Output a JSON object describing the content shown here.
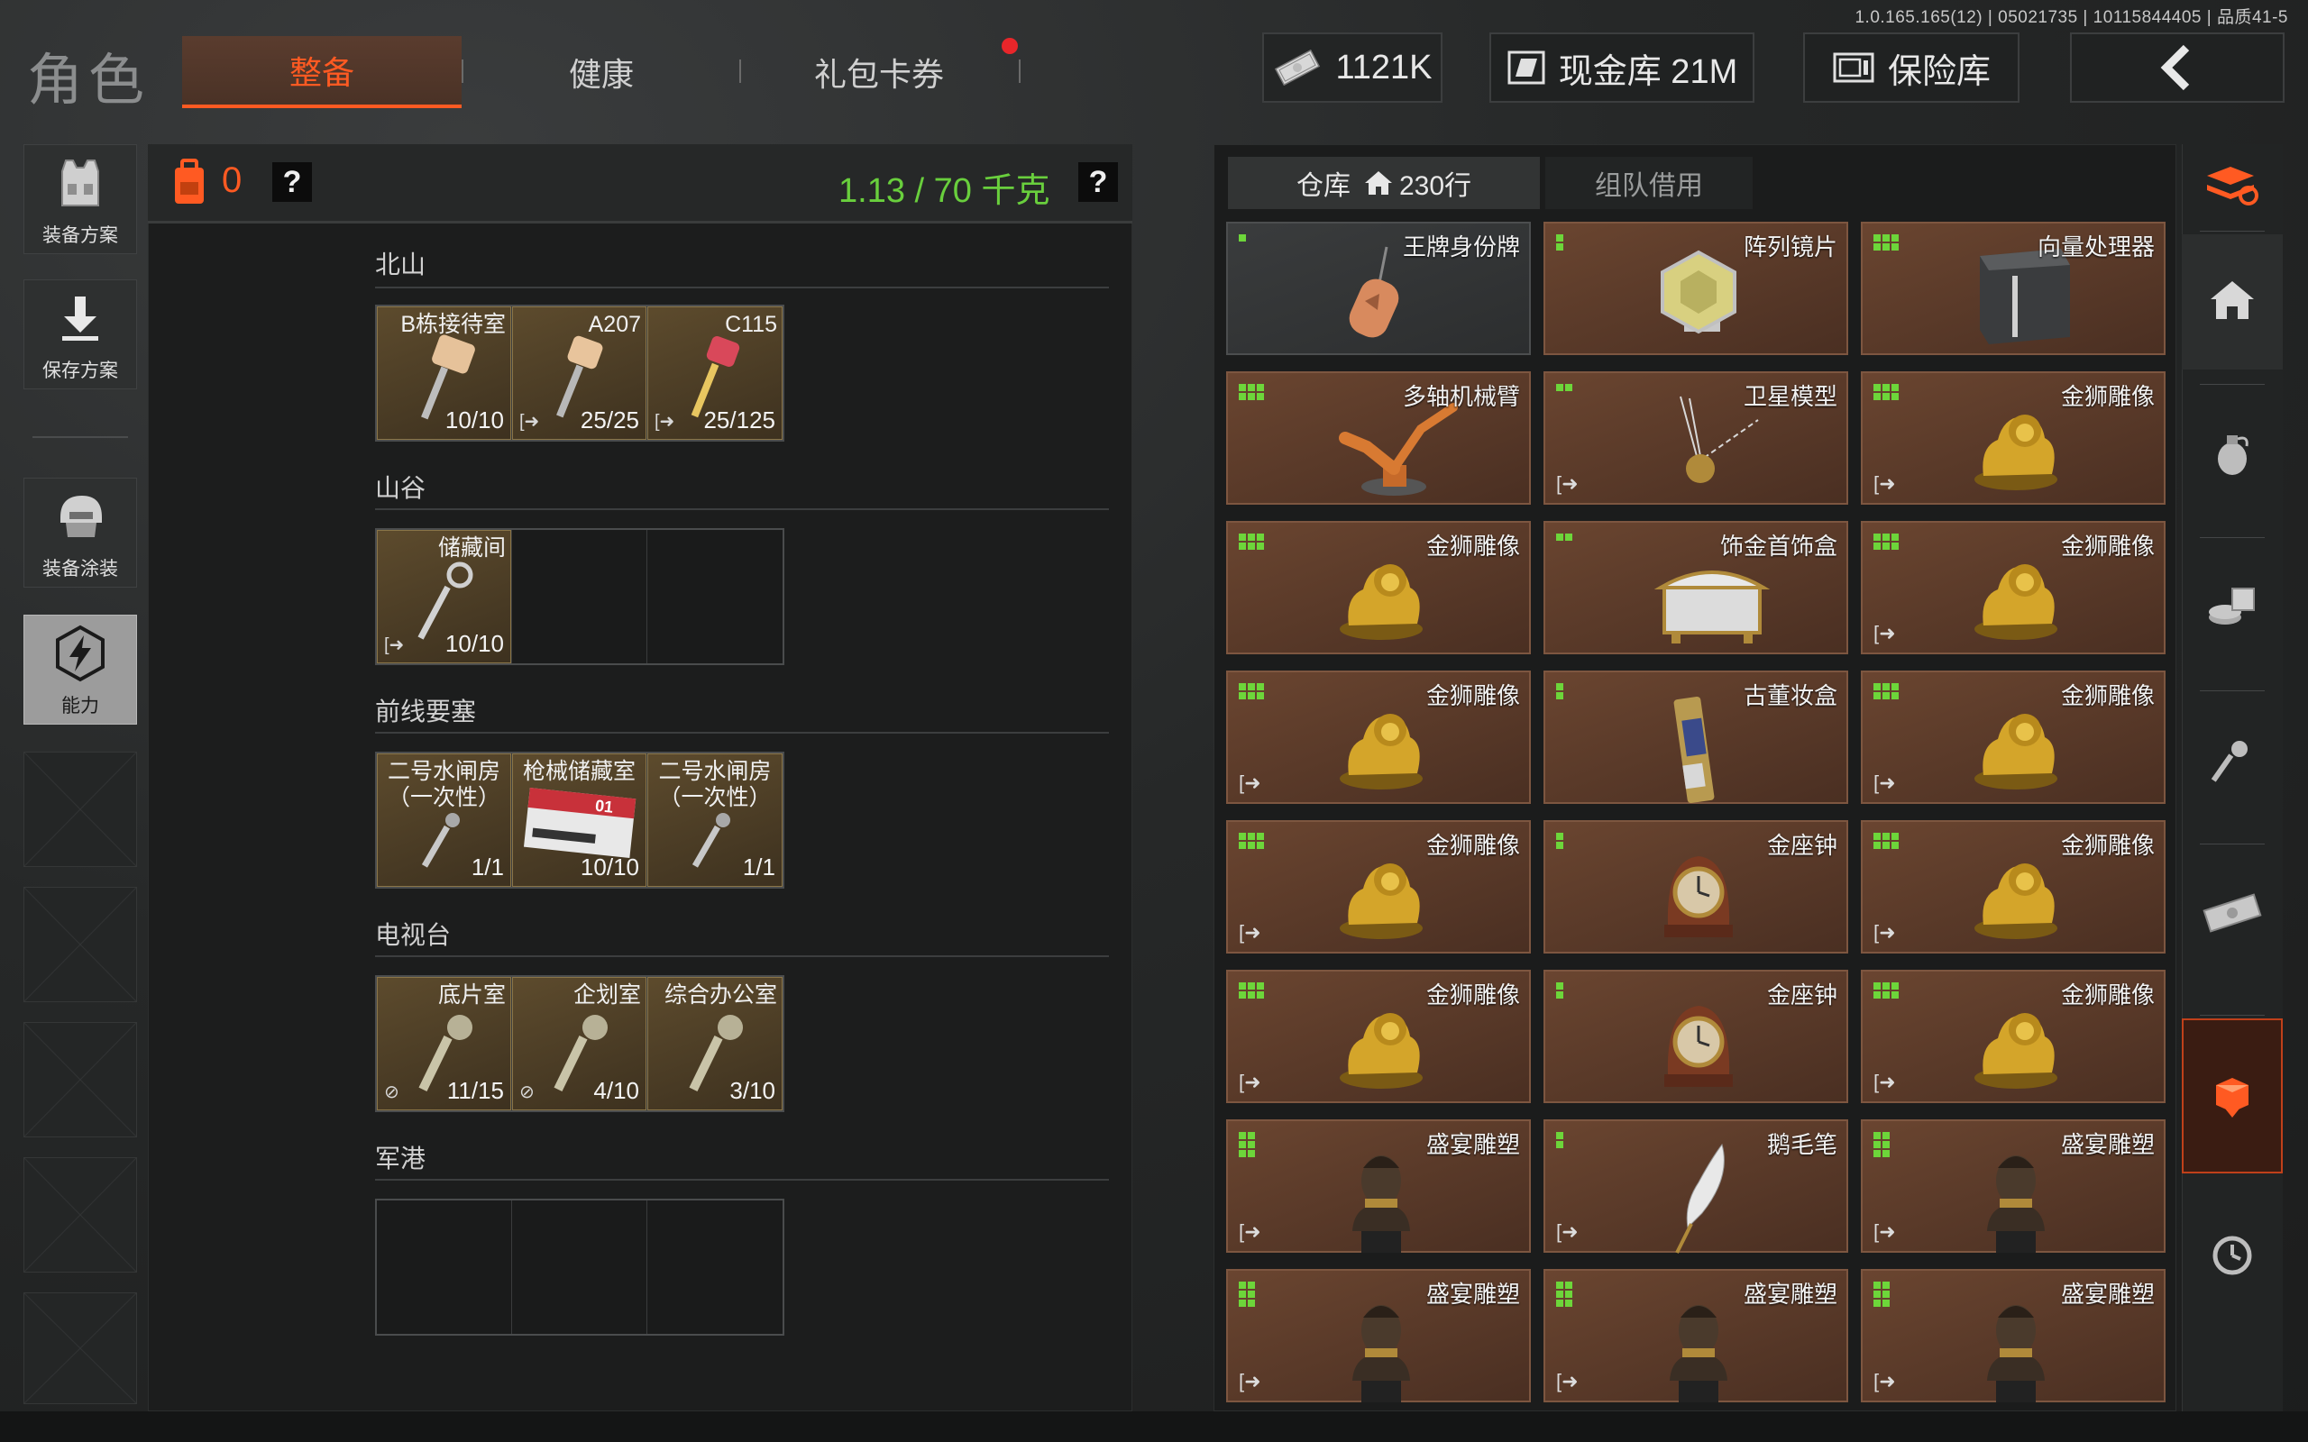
{
  "version": "1.0.165.165(12) | 05021735 | 10115844405 | 品质41-5",
  "page_title": "角色",
  "top_tabs": [
    {
      "label": "整备",
      "active": true
    },
    {
      "label": "健康",
      "active": false
    },
    {
      "label": "礼包卡券",
      "active": false,
      "badge": "red-dot"
    }
  ],
  "currency": {
    "label": "1121K",
    "icon": "cash-icon"
  },
  "cash_vault": {
    "label": "现金库 21M",
    "icon": "vault-icon"
  },
  "safe": {
    "label": "保险库",
    "icon": "safe-icon"
  },
  "back": {
    "icon": "back-arrow-icon"
  },
  "left_rail": [
    {
      "label": "装备方案",
      "icon": "vest-icon"
    },
    {
      "label": "保存方案",
      "icon": "download-icon"
    },
    {
      "label": "装备涂装",
      "icon": "helmet-icon"
    },
    {
      "label": "能力",
      "icon": "ability-icon",
      "active": true
    }
  ],
  "backpack": {
    "count": "0",
    "help": "?"
  },
  "weight": {
    "label": "1.13 / 70 千克",
    "help": "?"
  },
  "sections": [
    {
      "title": "北山",
      "keys": [
        {
          "name": "B栋接待室",
          "count": "10/10",
          "exit": false
        },
        {
          "name": "A207",
          "count": "25/25",
          "exit": true
        },
        {
          "name": "C115",
          "count": "25/125",
          "exit": true
        }
      ]
    },
    {
      "title": "山谷",
      "keys": [
        {
          "name": "储藏间",
          "count": "10/10",
          "exit": true
        }
      ]
    },
    {
      "title": "前线要塞",
      "keys": [
        {
          "name": "二号水闸房\n（一次性）",
          "count": "1/1",
          "exit": false
        },
        {
          "name": "枪械储藏室",
          "count": "10/10",
          "exit": false
        },
        {
          "name": "二号水闸房\n（一次性）",
          "count": "1/1",
          "exit": false
        }
      ]
    },
    {
      "title": "电视台",
      "keys": [
        {
          "name": "底片室",
          "count": "11/15",
          "exit": true
        },
        {
          "name": "企划室",
          "count": "4/10",
          "exit": true
        },
        {
          "name": "综合办公室",
          "count": "3/10",
          "exit": false
        }
      ]
    },
    {
      "title": "军港",
      "keys": []
    }
  ],
  "warehouse_tabs": [
    {
      "label": "仓库",
      "suffix": "230行",
      "icon": "home-icon",
      "active": true
    },
    {
      "label": "组队借用",
      "active": false
    }
  ],
  "items": [
    {
      "name": "王牌身份牌",
      "grid": "1x1",
      "exit": false,
      "art": "dogtag",
      "gray": true
    },
    {
      "name": "阵列镜片",
      "grid": "1x2",
      "exit": false,
      "art": "lens"
    },
    {
      "name": "向量处理器",
      "grid": "3x2",
      "exit": false,
      "art": "box"
    },
    {
      "name": "多轴机械臂",
      "grid": "3x2",
      "exit": false,
      "art": "arm"
    },
    {
      "name": "卫星模型",
      "grid": "2x1",
      "exit": true,
      "art": "satellite"
    },
    {
      "name": "金狮雕像",
      "grid": "3x2",
      "exit": true,
      "art": "lion"
    },
    {
      "name": "金狮雕像",
      "grid": "3x2",
      "exit": false,
      "art": "lion"
    },
    {
      "name": "饰金首饰盒",
      "grid": "2x1",
      "exit": false,
      "art": "jewelbox"
    },
    {
      "name": "金狮雕像",
      "grid": "3x2",
      "exit": true,
      "art": "lion"
    },
    {
      "name": "金狮雕像",
      "grid": "3x2",
      "exit": true,
      "art": "lion"
    },
    {
      "name": "古董妆盒",
      "grid": "1x2",
      "exit": false,
      "art": "vase"
    },
    {
      "name": "金狮雕像",
      "grid": "3x2",
      "exit": true,
      "art": "lion"
    },
    {
      "name": "金狮雕像",
      "grid": "3x2",
      "exit": true,
      "art": "lion"
    },
    {
      "name": "金座钟",
      "grid": "1x2",
      "exit": false,
      "art": "clock"
    },
    {
      "name": "金狮雕像",
      "grid": "3x2",
      "exit": true,
      "art": "lion"
    },
    {
      "name": "金狮雕像",
      "grid": "3x2",
      "exit": true,
      "art": "lion"
    },
    {
      "name": "金座钟",
      "grid": "1x2",
      "exit": false,
      "art": "clock"
    },
    {
      "name": "金狮雕像",
      "grid": "3x2",
      "exit": true,
      "art": "lion"
    },
    {
      "name": "盛宴雕塑",
      "grid": "2x3",
      "exit": true,
      "art": "bust"
    },
    {
      "name": "鹅毛笔",
      "grid": "1x2",
      "exit": true,
      "art": "quill"
    },
    {
      "name": "盛宴雕塑",
      "grid": "2x3",
      "exit": true,
      "art": "bust"
    },
    {
      "name": "盛宴雕塑",
      "grid": "2x3",
      "exit": true,
      "art": "bust"
    },
    {
      "name": "盛宴雕塑",
      "grid": "2x3",
      "exit": true,
      "art": "bust"
    },
    {
      "name": "盛宴雕塑",
      "grid": "2x3",
      "exit": true,
      "art": "bust"
    }
  ],
  "right_rail": [
    {
      "icon": "stack-refresh-icon",
      "active": false
    },
    {
      "icon": "home-icon",
      "active": false
    },
    {
      "icon": "grenade-icon",
      "active": false
    },
    {
      "icon": "coins-icon",
      "active": false
    },
    {
      "icon": "key-icon",
      "active": false
    },
    {
      "icon": "money-icon",
      "active": false
    },
    {
      "icon": "box-down-icon",
      "active": true
    },
    {
      "icon": "clock-icon",
      "active": false
    }
  ],
  "colors": {
    "accent": "#ff5a22",
    "weight_green": "#69cf3d",
    "grid_green": "#6dd63a",
    "item_brown": "#5a3a29",
    "badge_red": "#e8262a"
  }
}
